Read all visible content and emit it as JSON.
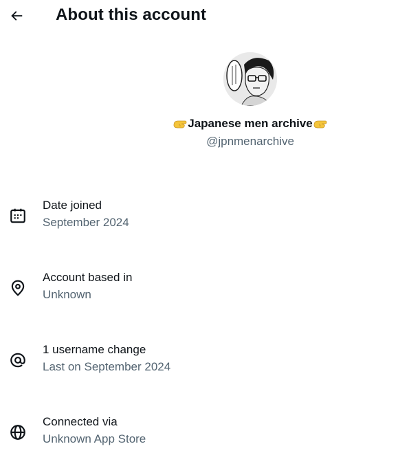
{
  "header": {
    "back_icon": "arrow-left-icon",
    "title": "About this account"
  },
  "profile": {
    "avatar_icon": "manga-portrait-avatar",
    "display_name": "Japanese men archive",
    "name_prefix_emoji": "hand-icon",
    "name_suffix_emoji": "hand-icon",
    "handle": "@jpnmenarchive"
  },
  "details": [
    {
      "icon": "calendar-icon",
      "label": "Date joined",
      "value": "September 2024"
    },
    {
      "icon": "location-pin-icon",
      "label": "Account based in",
      "value": "Unknown"
    },
    {
      "icon": "at-sign-icon",
      "label": "1 username change",
      "value": "Last on September 2024"
    },
    {
      "icon": "globe-icon",
      "label": "Connected via",
      "value": "Unknown App Store"
    }
  ],
  "colors": {
    "text_primary": "#0f1419",
    "text_secondary": "#536471",
    "background": "#ffffff",
    "emoji_yellow": "#f5c53b"
  }
}
